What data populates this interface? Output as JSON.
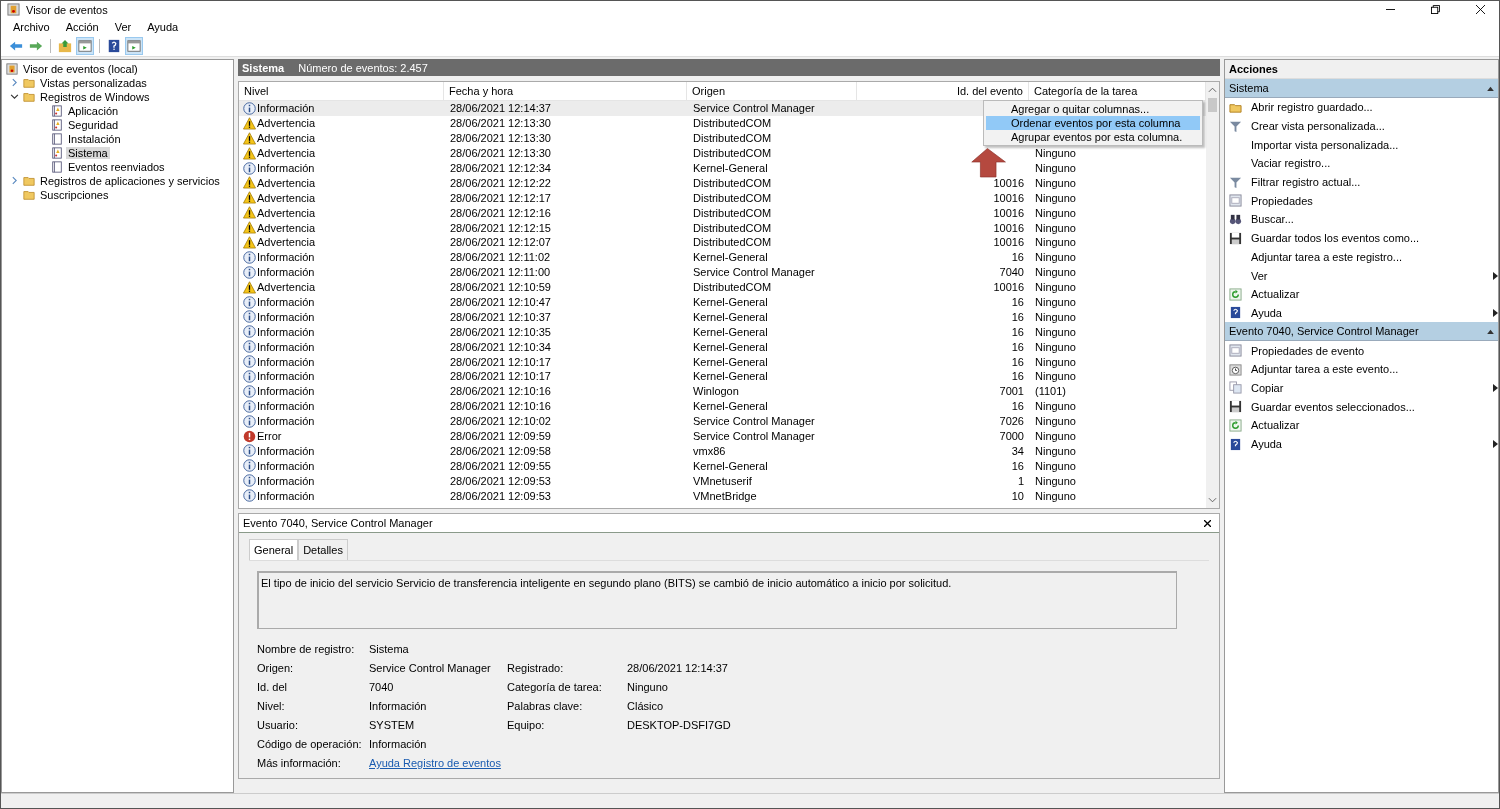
{
  "window": {
    "title": "Visor de eventos"
  },
  "menu": [
    "Archivo",
    "Acción",
    "Ver",
    "Ayuda"
  ],
  "toolbar": [
    {
      "kind": "back",
      "pressed": false
    },
    {
      "kind": "forward",
      "pressed": false
    },
    {
      "kind": "up",
      "pressed": false
    },
    {
      "kind": "tree",
      "pressed": true
    },
    {
      "kind": "help",
      "pressed": false
    },
    {
      "kind": "actions",
      "pressed": true
    }
  ],
  "tree": [
    {
      "label": "Visor de eventos (local)",
      "kind": "root",
      "selected": false,
      "children": [
        {
          "label": "Vistas personalizadas",
          "kind": "folder",
          "expanded": false,
          "selected": false
        },
        {
          "label": "Registros de Windows",
          "kind": "folder",
          "expanded": true,
          "selected": false,
          "children": [
            {
              "label": "Aplicación",
              "kind": "log",
              "selected": false
            },
            {
              "label": "Seguridad",
              "kind": "log",
              "selected": false
            },
            {
              "label": "Instalación",
              "kind": "plainlog",
              "selected": false
            },
            {
              "label": "Sistema",
              "kind": "log",
              "selected": true
            },
            {
              "label": "Eventos reenviados",
              "kind": "plainlog",
              "selected": false
            }
          ]
        },
        {
          "label": "Registros de aplicaciones y servicios",
          "kind": "folder",
          "expanded": false,
          "selected": false
        },
        {
          "label": "Suscripciones",
          "kind": "folder",
          "selected": false
        }
      ]
    }
  ],
  "log_header": {
    "name": "Sistema",
    "count": "Número de eventos: 2.457"
  },
  "table": {
    "columns": [
      "Nivel",
      "Fecha y hora",
      "Origen",
      "Id. del evento",
      "Categoría de la tarea"
    ],
    "rows": [
      {
        "kind": "info",
        "level": "Información",
        "date": "28/06/2021 12:14:37",
        "source": "Service Control Manager",
        "selected": true
      },
      {
        "kind": "warning",
        "level": "Advertencia",
        "date": "28/06/2021 12:13:30",
        "source": "DistributedCOM",
        "selected": false
      },
      {
        "kind": "warning",
        "level": "Advertencia",
        "date": "28/06/2021 12:13:30",
        "source": "DistributedCOM",
        "selected": false
      },
      {
        "kind": "warning",
        "level": "Advertencia",
        "date": "28/06/2021 12:13:30",
        "source": "DistributedCOM",
        "category": "Ninguno",
        "selected": false
      },
      {
        "kind": "info",
        "level": "Información",
        "date": "28/06/2021 12:12:34",
        "source": "Kernel-General",
        "category": "Ninguno",
        "selected": false
      },
      {
        "kind": "warning",
        "level": "Advertencia",
        "date": "28/06/2021 12:12:22",
        "source": "DistributedCOM",
        "id": "10016",
        "category": "Ninguno",
        "selected": false
      },
      {
        "kind": "warning",
        "level": "Advertencia",
        "date": "28/06/2021 12:12:17",
        "source": "DistributedCOM",
        "id": "10016",
        "category": "Ninguno",
        "selected": false
      },
      {
        "kind": "warning",
        "level": "Advertencia",
        "date": "28/06/2021 12:12:16",
        "source": "DistributedCOM",
        "id": "10016",
        "category": "Ninguno",
        "selected": false
      },
      {
        "kind": "warning",
        "level": "Advertencia",
        "date": "28/06/2021 12:12:15",
        "source": "DistributedCOM",
        "id": "10016",
        "category": "Ninguno",
        "selected": false
      },
      {
        "kind": "warning",
        "level": "Advertencia",
        "date": "28/06/2021 12:12:07",
        "source": "DistributedCOM",
        "id": "10016",
        "category": "Ninguno",
        "selected": false
      },
      {
        "kind": "info",
        "level": "Información",
        "date": "28/06/2021 12:11:02",
        "source": "Kernel-General",
        "id": "16",
        "category": "Ninguno",
        "selected": false
      },
      {
        "kind": "info",
        "level": "Información",
        "date": "28/06/2021 12:11:00",
        "source": "Service Control Manager",
        "id": "7040",
        "category": "Ninguno",
        "selected": false
      },
      {
        "kind": "warning",
        "level": "Advertencia",
        "date": "28/06/2021 12:10:59",
        "source": "DistributedCOM",
        "id": "10016",
        "category": "Ninguno",
        "selected": false
      },
      {
        "kind": "info",
        "level": "Información",
        "date": "28/06/2021 12:10:47",
        "source": "Kernel-General",
        "id": "16",
        "category": "Ninguno",
        "selected": false
      },
      {
        "kind": "info",
        "level": "Información",
        "date": "28/06/2021 12:10:37",
        "source": "Kernel-General",
        "id": "16",
        "category": "Ninguno",
        "selected": false
      },
      {
        "kind": "info",
        "level": "Información",
        "date": "28/06/2021 12:10:35",
        "source": "Kernel-General",
        "id": "16",
        "category": "Ninguno",
        "selected": false
      },
      {
        "kind": "info",
        "level": "Información",
        "date": "28/06/2021 12:10:34",
        "source": "Kernel-General",
        "id": "16",
        "category": "Ninguno",
        "selected": false
      },
      {
        "kind": "info",
        "level": "Información",
        "date": "28/06/2021 12:10:17",
        "source": "Kernel-General",
        "id": "16",
        "category": "Ninguno",
        "selected": false
      },
      {
        "kind": "info",
        "level": "Información",
        "date": "28/06/2021 12:10:17",
        "source": "Kernel-General",
        "id": "16",
        "category": "Ninguno",
        "selected": false
      },
      {
        "kind": "info",
        "level": "Información",
        "date": "28/06/2021 12:10:16",
        "source": "Winlogon",
        "id": "7001",
        "category": "(1101)",
        "selected": false
      },
      {
        "kind": "info",
        "level": "Información",
        "date": "28/06/2021 12:10:16",
        "source": "Kernel-General",
        "id": "16",
        "category": "Ninguno",
        "selected": false
      },
      {
        "kind": "info",
        "level": "Información",
        "date": "28/06/2021 12:10:02",
        "source": "Service Control Manager",
        "id": "7026",
        "category": "Ninguno",
        "selected": false
      },
      {
        "kind": "error",
        "level": "Error",
        "date": "28/06/2021 12:09:59",
        "source": "Service Control Manager",
        "id": "7000",
        "category": "Ninguno",
        "selected": false
      },
      {
        "kind": "info",
        "level": "Información",
        "date": "28/06/2021 12:09:58",
        "source": "vmx86",
        "id": "34",
        "category": "Ninguno",
        "selected": false
      },
      {
        "kind": "info",
        "level": "Información",
        "date": "28/06/2021 12:09:55",
        "source": "Kernel-General",
        "id": "16",
        "category": "Ninguno",
        "selected": false
      },
      {
        "kind": "info",
        "level": "Información",
        "date": "28/06/2021 12:09:53",
        "source": "VMnetuserif",
        "id": "1",
        "category": "Ninguno",
        "selected": false
      },
      {
        "kind": "info",
        "level": "Información",
        "date": "28/06/2021 12:09:53",
        "source": "VMnetBridge",
        "id": "10",
        "category": "Ninguno",
        "selected": false
      }
    ]
  },
  "context_menu": [
    {
      "label": "Agregar o quitar columnas...",
      "selected": false
    },
    {
      "label": "Ordenar eventos por esta columna",
      "selected": true
    },
    {
      "label": "Agrupar eventos por esta columna.",
      "selected": false
    }
  ],
  "detail": {
    "title": "Evento 7040, Service Control Manager",
    "tabs": [
      {
        "label": "General",
        "selected": true
      },
      {
        "label": "Detalles",
        "selected": false
      }
    ],
    "description": "El tipo de inicio del servicio Servicio de transferencia inteligente en segundo plano (BITS) se cambió de inicio automático a inicio por solicitud.",
    "fields": [
      {
        "label": "Nombre de registro:",
        "value": "Sistema"
      },
      {
        "label": "Origen:",
        "value": "Service Control Manager",
        "label2": "Registrado:",
        "value2": "28/06/2021 12:14:37"
      },
      {
        "label": "Id. del",
        "value": "7040",
        "label2": "Categoría de tarea:",
        "value2": "Ninguno"
      },
      {
        "label": "Nivel:",
        "value": "Información",
        "label2": "Palabras clave:",
        "value2": "Clásico"
      },
      {
        "label": "Usuario:",
        "value": "SYSTEM",
        "label2": "Equipo:",
        "value2": "DESKTOP-DSFI7GD"
      },
      {
        "label": "Código de operación:",
        "value": "Información"
      },
      {
        "label": "Más información:",
        "value": "Ayuda Registro de eventos",
        "kind": "link"
      }
    ]
  },
  "actions": {
    "title": "Acciones",
    "sections": [
      {
        "title": "Sistema",
        "items": [
          {
            "label": "Abrir registro guardado...",
            "kind": "open",
            "submenu": false
          },
          {
            "label": "Crear vista personalizada...",
            "kind": "filter",
            "submenu": false
          },
          {
            "label": "Importar vista personalizada...",
            "kind": "none",
            "submenu": false
          },
          {
            "label": "Vaciar registro...",
            "kind": "none",
            "submenu": false
          },
          {
            "label": "Filtrar registro actual...",
            "kind": "filter",
            "submenu": false
          },
          {
            "label": "Propiedades",
            "kind": "properties",
            "submenu": false
          },
          {
            "label": "Buscar...",
            "kind": "find",
            "submenu": false
          },
          {
            "label": "Guardar todos los eventos como...",
            "kind": "save",
            "submenu": false
          },
          {
            "label": "Adjuntar tarea a este registro...",
            "kind": "none",
            "submenu": false
          },
          {
            "label": "Ver",
            "kind": "none",
            "submenu": true
          },
          {
            "label": "Actualizar",
            "kind": "refresh",
            "submenu": false
          },
          {
            "label": "Ayuda",
            "kind": "help",
            "submenu": true
          }
        ]
      },
      {
        "title": "Evento 7040, Service Control Manager",
        "items": [
          {
            "label": "Propiedades de evento",
            "kind": "properties",
            "submenu": false
          },
          {
            "label": "Adjuntar tarea a este evento...",
            "kind": "task",
            "submenu": false
          },
          {
            "label": "Copiar",
            "kind": "copy",
            "submenu": true
          },
          {
            "label": "Guardar eventos seleccionados...",
            "kind": "save",
            "submenu": false
          },
          {
            "label": "Actualizar",
            "kind": "refresh",
            "submenu": false
          },
          {
            "label": "Ayuda",
            "kind": "help",
            "submenu": true
          }
        ]
      }
    ]
  }
}
